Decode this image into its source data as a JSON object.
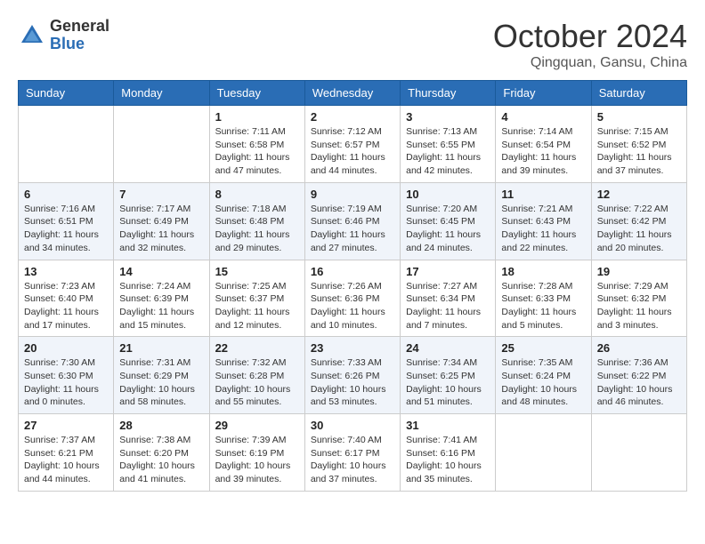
{
  "logo": {
    "general": "General",
    "blue": "Blue"
  },
  "header": {
    "month": "October 2024",
    "location": "Qingquan, Gansu, China"
  },
  "weekdays": [
    "Sunday",
    "Monday",
    "Tuesday",
    "Wednesday",
    "Thursday",
    "Friday",
    "Saturday"
  ],
  "weeks": [
    [
      {
        "day": null,
        "sunrise": null,
        "sunset": null,
        "daylight": null
      },
      {
        "day": null,
        "sunrise": null,
        "sunset": null,
        "daylight": null
      },
      {
        "day": 1,
        "sunrise": "Sunrise: 7:11 AM",
        "sunset": "Sunset: 6:58 PM",
        "daylight": "Daylight: 11 hours and 47 minutes."
      },
      {
        "day": 2,
        "sunrise": "Sunrise: 7:12 AM",
        "sunset": "Sunset: 6:57 PM",
        "daylight": "Daylight: 11 hours and 44 minutes."
      },
      {
        "day": 3,
        "sunrise": "Sunrise: 7:13 AM",
        "sunset": "Sunset: 6:55 PM",
        "daylight": "Daylight: 11 hours and 42 minutes."
      },
      {
        "day": 4,
        "sunrise": "Sunrise: 7:14 AM",
        "sunset": "Sunset: 6:54 PM",
        "daylight": "Daylight: 11 hours and 39 minutes."
      },
      {
        "day": 5,
        "sunrise": "Sunrise: 7:15 AM",
        "sunset": "Sunset: 6:52 PM",
        "daylight": "Daylight: 11 hours and 37 minutes."
      }
    ],
    [
      {
        "day": 6,
        "sunrise": "Sunrise: 7:16 AM",
        "sunset": "Sunset: 6:51 PM",
        "daylight": "Daylight: 11 hours and 34 minutes."
      },
      {
        "day": 7,
        "sunrise": "Sunrise: 7:17 AM",
        "sunset": "Sunset: 6:49 PM",
        "daylight": "Daylight: 11 hours and 32 minutes."
      },
      {
        "day": 8,
        "sunrise": "Sunrise: 7:18 AM",
        "sunset": "Sunset: 6:48 PM",
        "daylight": "Daylight: 11 hours and 29 minutes."
      },
      {
        "day": 9,
        "sunrise": "Sunrise: 7:19 AM",
        "sunset": "Sunset: 6:46 PM",
        "daylight": "Daylight: 11 hours and 27 minutes."
      },
      {
        "day": 10,
        "sunrise": "Sunrise: 7:20 AM",
        "sunset": "Sunset: 6:45 PM",
        "daylight": "Daylight: 11 hours and 24 minutes."
      },
      {
        "day": 11,
        "sunrise": "Sunrise: 7:21 AM",
        "sunset": "Sunset: 6:43 PM",
        "daylight": "Daylight: 11 hours and 22 minutes."
      },
      {
        "day": 12,
        "sunrise": "Sunrise: 7:22 AM",
        "sunset": "Sunset: 6:42 PM",
        "daylight": "Daylight: 11 hours and 20 minutes."
      }
    ],
    [
      {
        "day": 13,
        "sunrise": "Sunrise: 7:23 AM",
        "sunset": "Sunset: 6:40 PM",
        "daylight": "Daylight: 11 hours and 17 minutes."
      },
      {
        "day": 14,
        "sunrise": "Sunrise: 7:24 AM",
        "sunset": "Sunset: 6:39 PM",
        "daylight": "Daylight: 11 hours and 15 minutes."
      },
      {
        "day": 15,
        "sunrise": "Sunrise: 7:25 AM",
        "sunset": "Sunset: 6:37 PM",
        "daylight": "Daylight: 11 hours and 12 minutes."
      },
      {
        "day": 16,
        "sunrise": "Sunrise: 7:26 AM",
        "sunset": "Sunset: 6:36 PM",
        "daylight": "Daylight: 11 hours and 10 minutes."
      },
      {
        "day": 17,
        "sunrise": "Sunrise: 7:27 AM",
        "sunset": "Sunset: 6:34 PM",
        "daylight": "Daylight: 11 hours and 7 minutes."
      },
      {
        "day": 18,
        "sunrise": "Sunrise: 7:28 AM",
        "sunset": "Sunset: 6:33 PM",
        "daylight": "Daylight: 11 hours and 5 minutes."
      },
      {
        "day": 19,
        "sunrise": "Sunrise: 7:29 AM",
        "sunset": "Sunset: 6:32 PM",
        "daylight": "Daylight: 11 hours and 3 minutes."
      }
    ],
    [
      {
        "day": 20,
        "sunrise": "Sunrise: 7:30 AM",
        "sunset": "Sunset: 6:30 PM",
        "daylight": "Daylight: 11 hours and 0 minutes."
      },
      {
        "day": 21,
        "sunrise": "Sunrise: 7:31 AM",
        "sunset": "Sunset: 6:29 PM",
        "daylight": "Daylight: 10 hours and 58 minutes."
      },
      {
        "day": 22,
        "sunrise": "Sunrise: 7:32 AM",
        "sunset": "Sunset: 6:28 PM",
        "daylight": "Daylight: 10 hours and 55 minutes."
      },
      {
        "day": 23,
        "sunrise": "Sunrise: 7:33 AM",
        "sunset": "Sunset: 6:26 PM",
        "daylight": "Daylight: 10 hours and 53 minutes."
      },
      {
        "day": 24,
        "sunrise": "Sunrise: 7:34 AM",
        "sunset": "Sunset: 6:25 PM",
        "daylight": "Daylight: 10 hours and 51 minutes."
      },
      {
        "day": 25,
        "sunrise": "Sunrise: 7:35 AM",
        "sunset": "Sunset: 6:24 PM",
        "daylight": "Daylight: 10 hours and 48 minutes."
      },
      {
        "day": 26,
        "sunrise": "Sunrise: 7:36 AM",
        "sunset": "Sunset: 6:22 PM",
        "daylight": "Daylight: 10 hours and 46 minutes."
      }
    ],
    [
      {
        "day": 27,
        "sunrise": "Sunrise: 7:37 AM",
        "sunset": "Sunset: 6:21 PM",
        "daylight": "Daylight: 10 hours and 44 minutes."
      },
      {
        "day": 28,
        "sunrise": "Sunrise: 7:38 AM",
        "sunset": "Sunset: 6:20 PM",
        "daylight": "Daylight: 10 hours and 41 minutes."
      },
      {
        "day": 29,
        "sunrise": "Sunrise: 7:39 AM",
        "sunset": "Sunset: 6:19 PM",
        "daylight": "Daylight: 10 hours and 39 minutes."
      },
      {
        "day": 30,
        "sunrise": "Sunrise: 7:40 AM",
        "sunset": "Sunset: 6:17 PM",
        "daylight": "Daylight: 10 hours and 37 minutes."
      },
      {
        "day": 31,
        "sunrise": "Sunrise: 7:41 AM",
        "sunset": "Sunset: 6:16 PM",
        "daylight": "Daylight: 10 hours and 35 minutes."
      },
      {
        "day": null,
        "sunrise": null,
        "sunset": null,
        "daylight": null
      },
      {
        "day": null,
        "sunrise": null,
        "sunset": null,
        "daylight": null
      }
    ]
  ]
}
